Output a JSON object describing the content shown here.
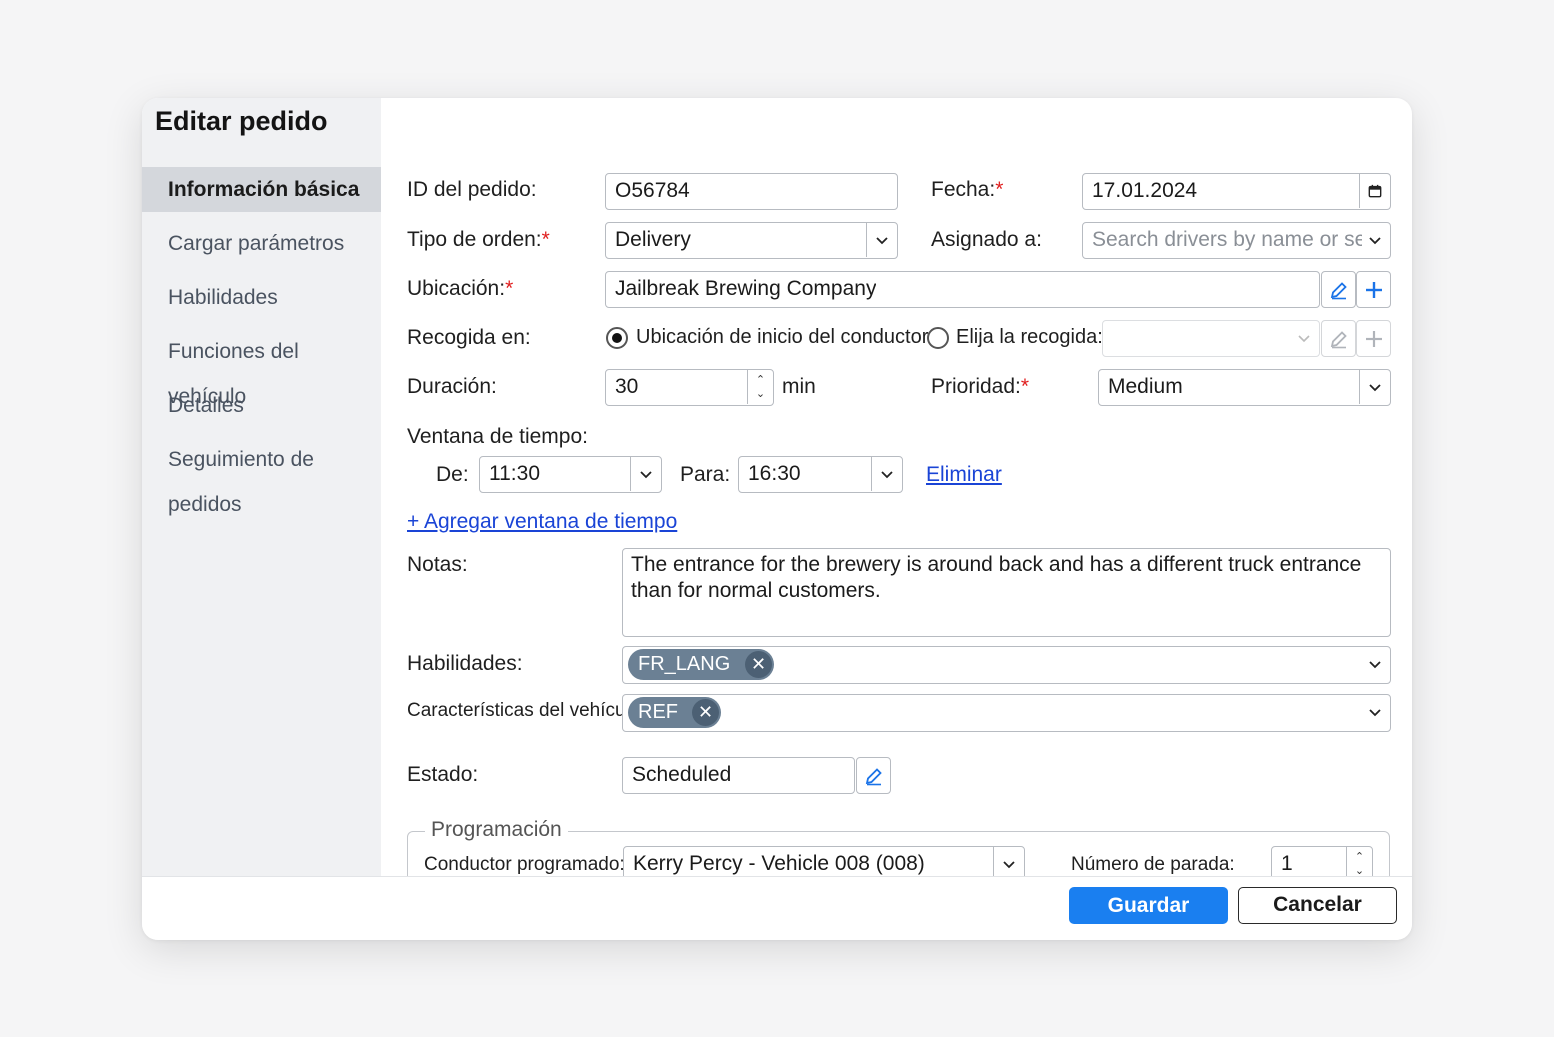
{
  "dialog": {
    "title": "Editar pedido"
  },
  "sidebar": {
    "items": [
      {
        "label": "Información básica",
        "active": true
      },
      {
        "label": "Cargar parámetros"
      },
      {
        "label": "Habilidades"
      },
      {
        "label": "Funciones del vehículo"
      },
      {
        "label": "Detalles"
      },
      {
        "label": "Seguimiento de pedidos"
      }
    ]
  },
  "form": {
    "order_id": {
      "label": "ID del pedido:",
      "value": "O56784"
    },
    "date": {
      "label": "Fecha:",
      "required_mark": "*",
      "value": "17.01.2024",
      "icon": "calendar-icon"
    },
    "order_type": {
      "label": "Tipo de orden:",
      "required_mark": "*",
      "value": "Delivery"
    },
    "assigned_to": {
      "label": "Asignado a:",
      "placeholder": "Search drivers by name or se"
    },
    "location": {
      "label": "Ubicación:",
      "required_mark": "*",
      "value": "Jailbreak Brewing Company"
    },
    "pickup": {
      "label": "Recogida en:",
      "option_driver_start": "Ubicación de inicio del conductor",
      "option_choose": "Elija la recogida:",
      "selected": "driver_start"
    },
    "duration": {
      "label": "Duración:",
      "value": "30",
      "unit": "min"
    },
    "priority": {
      "label": "Prioridad:",
      "required_mark": "*",
      "value": "Medium"
    },
    "time_window": {
      "label": "Ventana de tiempo:",
      "from_label": "De:",
      "from_value": "11:30",
      "to_label": "Para:",
      "to_value": "16:30",
      "remove_link": "Eliminar",
      "add_link": "+ Agregar ventana de tiempo"
    },
    "notes": {
      "label": "Notas:",
      "value": "The entrance for the brewery is around back and has a different truck entrance than for normal customers."
    },
    "skills": {
      "label": "Habilidades:",
      "chips": [
        "FR_LANG"
      ]
    },
    "vehicle_features": {
      "label": "Características del vehículo:",
      "chips": [
        "REF"
      ]
    },
    "status": {
      "label": "Estado:",
      "value": "Scheduled"
    },
    "scheduling": {
      "legend": "Programación",
      "driver_label": "Conductor programado:",
      "driver_value": "Kerry Percy - Vehicle 008 (008)",
      "stop_label": "Número de parada:",
      "stop_value": "1"
    }
  },
  "footer": {
    "save_label": "Guardar",
    "cancel_label": "Cancelar"
  },
  "colors": {
    "primary": "#1a7ff0",
    "link": "#1a44d6",
    "required": "#e02020",
    "chip": "#6b8094"
  }
}
